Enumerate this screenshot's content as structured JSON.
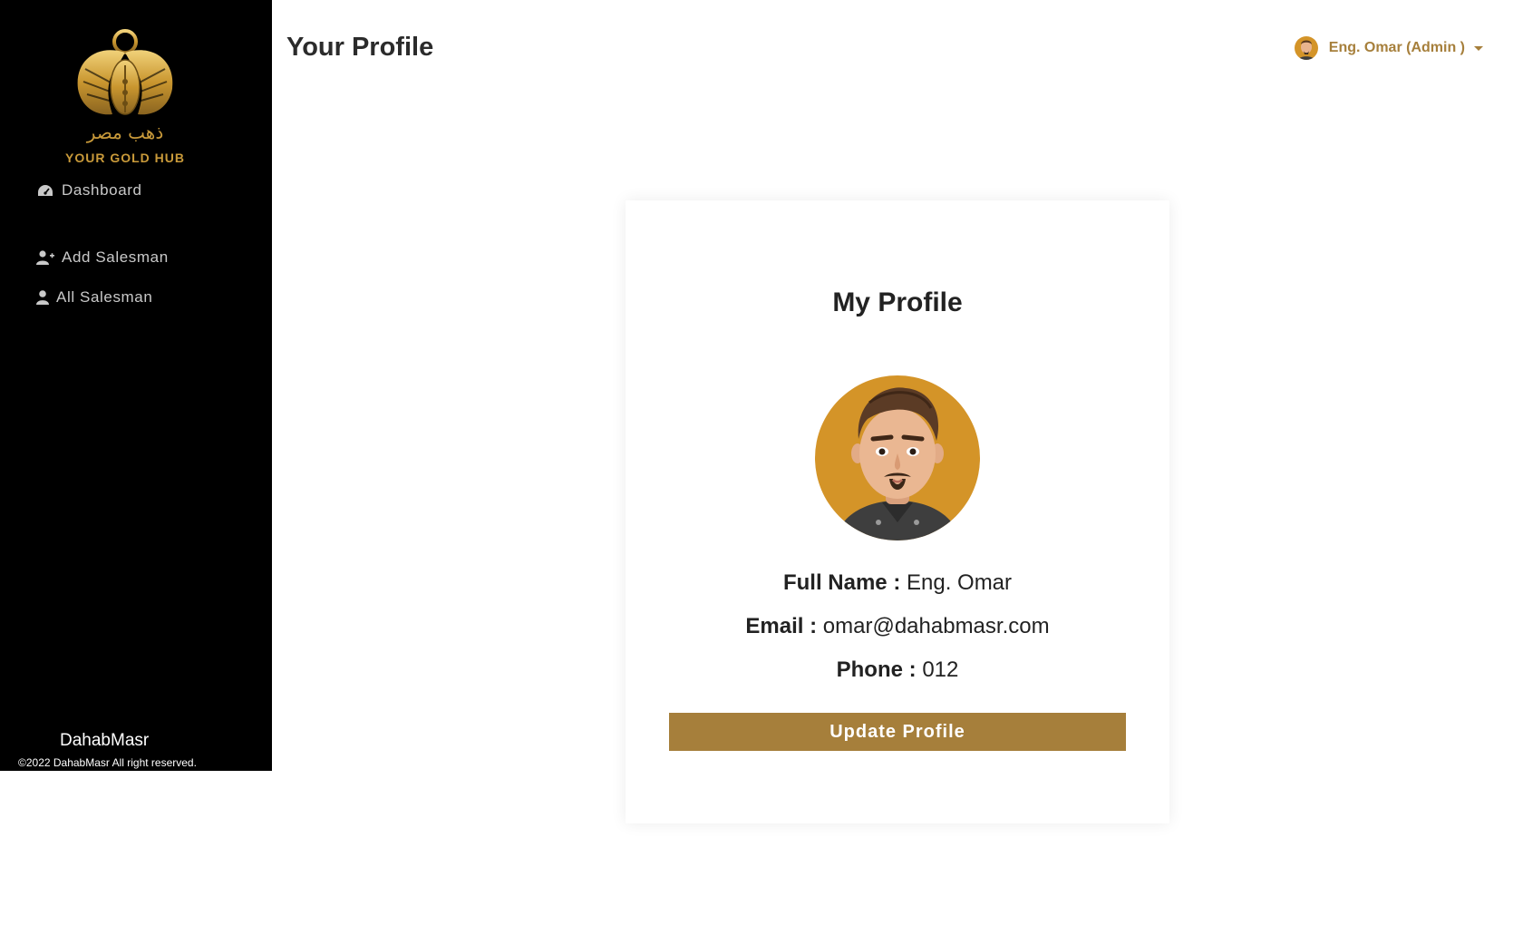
{
  "sidebar": {
    "logo": {
      "arabic_text": "ذهب مصر",
      "tagline": "YOUR GOLD HUB"
    },
    "items": [
      {
        "label": "Dashboard",
        "icon": "dashboard-gauge-icon"
      },
      {
        "label": "Add Salesman",
        "icon": "user-plus-icon"
      },
      {
        "label": "All Salesman",
        "icon": "user-icon"
      }
    ],
    "footer": {
      "brand": "DahabMasr",
      "copyright": "©2022 DahabMasr All right reserved."
    }
  },
  "header": {
    "title": "Your Profile",
    "user": {
      "name": "Eng. Omar (Admin )",
      "icon": "chevron-down-icon"
    }
  },
  "profile": {
    "title": "My Profile",
    "full_name_label": "Full Name :",
    "full_name": "Eng. Omar",
    "email_label": "Email :",
    "email": "omar@dahabmasr.com",
    "phone_label": "Phone :",
    "phone": "012",
    "button_label": "Update Profile"
  },
  "colors": {
    "accent": "#a67f3b",
    "sidebar_bg": "#000000",
    "avatar_bg": "#d49428"
  }
}
